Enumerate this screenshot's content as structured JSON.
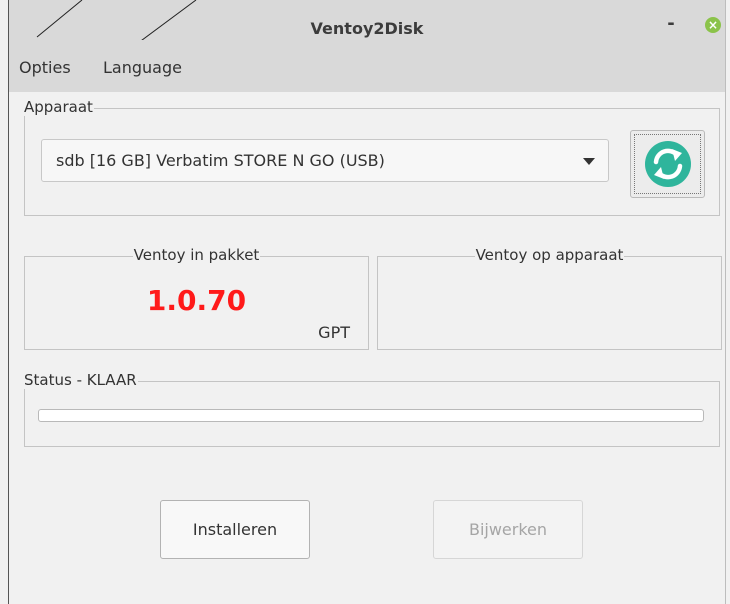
{
  "window": {
    "title": "Ventoy2Disk",
    "minimize_label": "-",
    "close_label": "×"
  },
  "menu": {
    "items": [
      "Opties",
      "Language"
    ]
  },
  "device_group": {
    "label": "Apparaat",
    "selected_device": "sdb  [16 GB]  Verbatim STORE N GO (USB)",
    "refresh_icon": "refresh-icon"
  },
  "package_group": {
    "label": "Ventoy in pakket",
    "version": "1.0.70",
    "partition_style": "GPT"
  },
  "device_version_group": {
    "label": "Ventoy op apparaat",
    "version": "",
    "partition_style": ""
  },
  "status_group": {
    "label": "Status - KLAAR",
    "progress": 0
  },
  "buttons": {
    "install": "Installeren",
    "update": "Bijwerken"
  },
  "colors": {
    "version_text": "#ff1a1a",
    "accent_teal": "#2fb59c",
    "close_button": "#8bc34a"
  }
}
